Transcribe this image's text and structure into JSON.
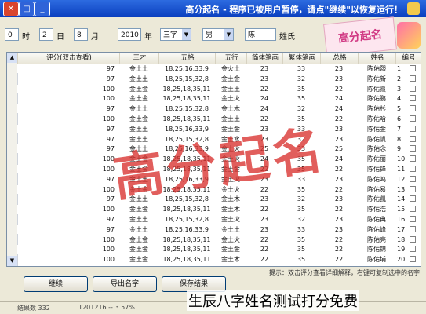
{
  "window": {
    "title": "高分起名 - 程序已被用户暂停，请点\"继续\"以恢复运行！"
  },
  "toolbar": {
    "hour_value": "0",
    "hour_unit": "时",
    "day_value": "2",
    "day_unit": "日",
    "month_value": "8",
    "month_unit": "月",
    "year_value": "2010",
    "year_unit": "年",
    "name_length_value": "三字",
    "gender_value": "男",
    "surname_label": "姓氏",
    "surname_value": "陈",
    "logo_text": "高分起名"
  },
  "table": {
    "columns": [
      "编号",
      "姓名",
      "总格",
      "繁体笔画",
      "简体笔画",
      "五行",
      "五格",
      "三才",
      "评分(双击查看)"
    ],
    "rows": [
      {
        "no": "1",
        "name": "陈佑熙",
        "total": "23",
        "trad": "33",
        "simp": "23",
        "wuxing": "金火土",
        "wuge": "18,25,16,33,9",
        "sancai": "金土土",
        "score": "97"
      },
      {
        "no": "2",
        "name": "陈佑新",
        "total": "23",
        "trad": "32",
        "simp": "23",
        "wuxing": "金土金",
        "wuge": "18,25,15,32,8",
        "sancai": "金土土",
        "score": "97"
      },
      {
        "no": "3",
        "name": "陈佑熹",
        "total": "22",
        "trad": "35",
        "simp": "22",
        "wuxing": "金土土",
        "wuge": "18,25,18,35,11",
        "sancai": "金土金",
        "score": "100"
      },
      {
        "no": "4",
        "name": "陈佑鹏",
        "total": "24",
        "trad": "35",
        "simp": "24",
        "wuxing": "金土火",
        "wuge": "18,25,18,35,11",
        "sancai": "金土金",
        "score": "100"
      },
      {
        "no": "5",
        "name": "陈佑杉",
        "total": "24",
        "trad": "32",
        "simp": "24",
        "wuxing": "金土木",
        "wuge": "18,25,15,32,8",
        "sancai": "金土土",
        "score": "97"
      },
      {
        "no": "6",
        "name": "陈佑晗",
        "total": "22",
        "trad": "35",
        "simp": "22",
        "wuxing": "金土土",
        "wuge": "18,25,18,35,11",
        "sancai": "金土金",
        "score": "100"
      },
      {
        "no": "7",
        "name": "陈佑金",
        "total": "23",
        "trad": "33",
        "simp": "23",
        "wuxing": "金土金",
        "wuge": "18,25,16,33,9",
        "sancai": "金土土",
        "score": "97"
      },
      {
        "no": "8",
        "name": "陈佑帆",
        "total": "23",
        "trad": "32",
        "simp": "23",
        "wuxing": "金土水",
        "wuge": "18,25,15,32,8",
        "sancai": "金土土",
        "score": "97"
      },
      {
        "no": "9",
        "name": "陈佑念",
        "total": "25",
        "trad": "33",
        "simp": "25",
        "wuxing": "金土火",
        "wuge": "18,25,16,33,9",
        "sancai": "金土土",
        "score": "97"
      },
      {
        "no": "10",
        "name": "陈佑丽",
        "total": "24",
        "trad": "35",
        "simp": "24",
        "wuxing": "金土火",
        "wuge": "18,25,18,35,11",
        "sancai": "金土金",
        "score": "100"
      },
      {
        "no": "11",
        "name": "陈佑锋",
        "total": "22",
        "trad": "35",
        "simp": "22",
        "wuxing": "金土金",
        "wuge": "18,25,18,35,11",
        "sancai": "金土金",
        "score": "100"
      },
      {
        "no": "12",
        "name": "陈佑鸣",
        "total": "23",
        "trad": "33",
        "simp": "23",
        "wuxing": "金土火",
        "wuge": "18,25,16,33,9",
        "sancai": "金土土",
        "score": "97"
      },
      {
        "no": "13",
        "name": "陈佑易",
        "total": "22",
        "trad": "35",
        "simp": "22",
        "wuxing": "金土火",
        "wuge": "18,25,18,35,11",
        "sancai": "金土金",
        "score": "100"
      },
      {
        "no": "14",
        "name": "陈佑凯",
        "total": "23",
        "trad": "32",
        "simp": "23",
        "wuxing": "金土木",
        "wuge": "18,25,15,32,8",
        "sancai": "金土土",
        "score": "97"
      },
      {
        "no": "15",
        "name": "陈佑浩",
        "total": "22",
        "trad": "35",
        "simp": "22",
        "wuxing": "金土木",
        "wuge": "18,25,18,35,11",
        "sancai": "金土金",
        "score": "100"
      },
      {
        "no": "16",
        "name": "陈佑典",
        "total": "23",
        "trad": "32",
        "simp": "23",
        "wuxing": "金土火",
        "wuge": "18,25,15,32,8",
        "sancai": "金土土",
        "score": "97"
      },
      {
        "no": "17",
        "name": "陈佑峰",
        "total": "23",
        "trad": "33",
        "simp": "23",
        "wuxing": "金土土",
        "wuge": "18,25,16,33,9",
        "sancai": "金土土",
        "score": "97"
      },
      {
        "no": "18",
        "name": "陈佑亮",
        "total": "22",
        "trad": "35",
        "simp": "22",
        "wuxing": "金土火",
        "wuge": "18,25,18,35,11",
        "sancai": "金土金",
        "score": "100"
      },
      {
        "no": "19",
        "name": "陈佑锦",
        "total": "22",
        "trad": "35",
        "simp": "22",
        "wuxing": "金土金",
        "wuge": "18,25,18,35,11",
        "sancai": "金土金",
        "score": "100"
      },
      {
        "no": "20",
        "name": "陈佑埔",
        "total": "22",
        "trad": "35",
        "simp": "22",
        "wuxing": "金土木",
        "wuge": "18,25,18,35,11",
        "sancai": "金土金",
        "score": "100"
      }
    ]
  },
  "bottom": {
    "hint": "提示：双击评分查看详细解释，右键可复制选中的名字",
    "btn_continue": "继续",
    "btn_export": "导出名字",
    "btn_save": "保存结果",
    "status_count": "结果数 332",
    "status_progress": "1201216 -- 3.57%"
  },
  "watermark_text": "高分起名",
  "caption": "生辰八字姓名测试打分免费"
}
